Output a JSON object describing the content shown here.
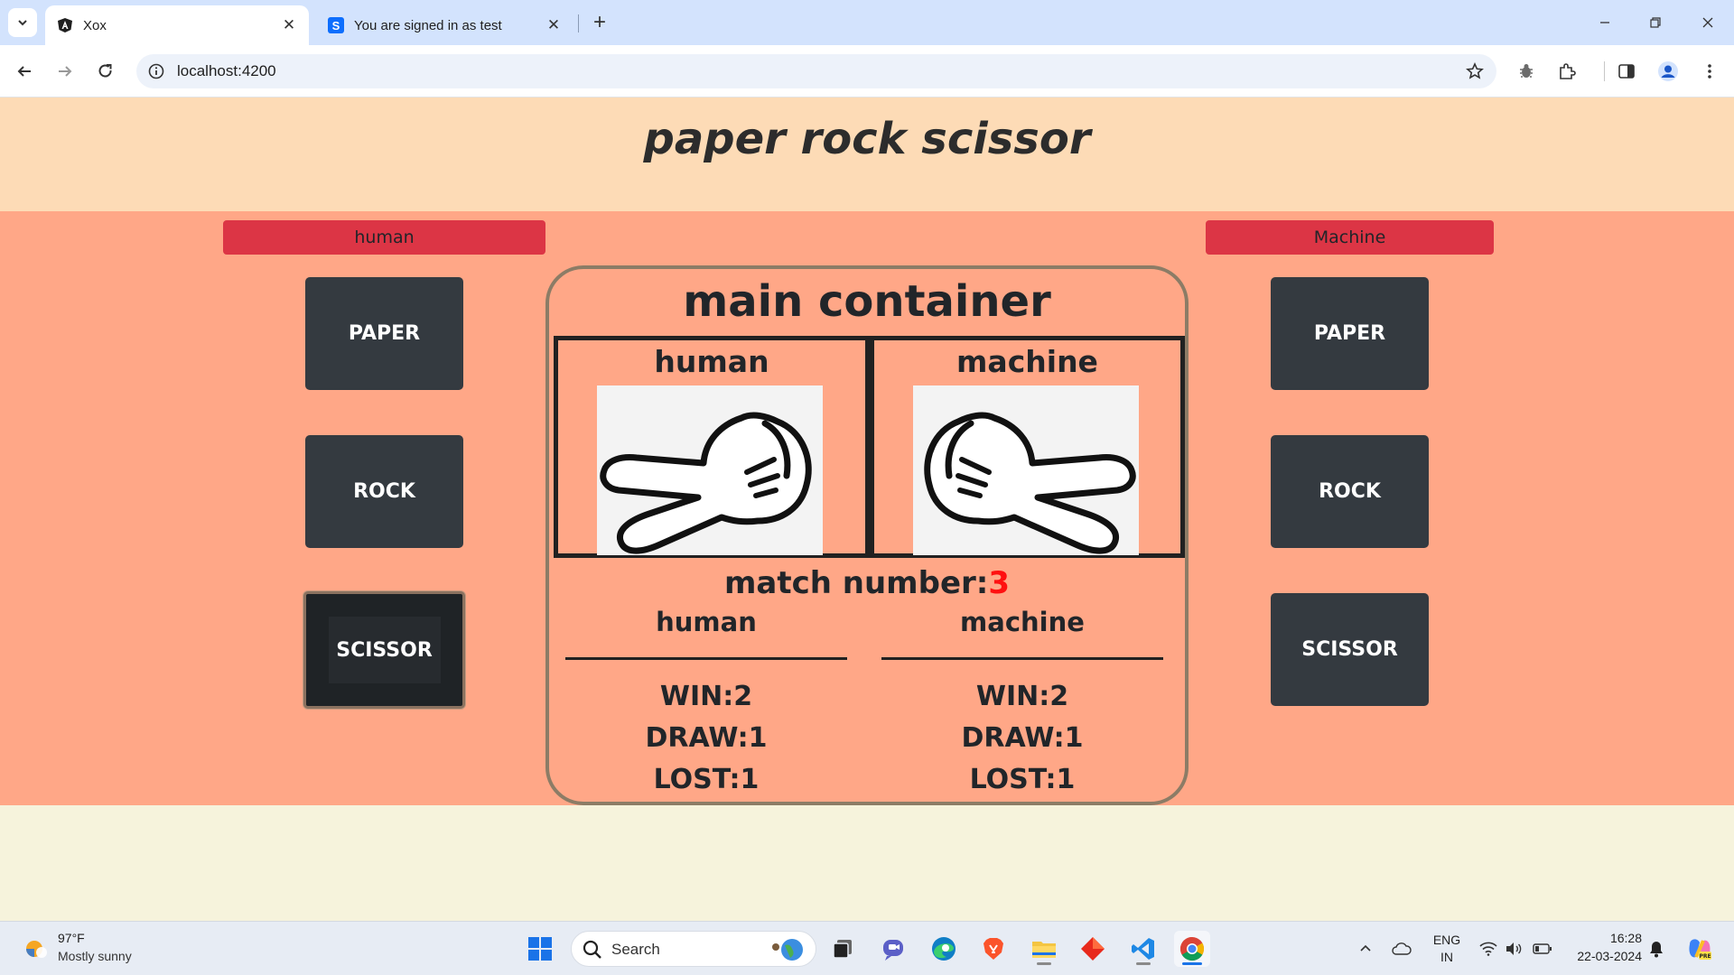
{
  "browser": {
    "tabs": [
      {
        "title": "Xox",
        "active": true,
        "favicon": "angular-icon"
      },
      {
        "title": "You are signed in as test",
        "active": false,
        "favicon": "s-logo-icon"
      }
    ],
    "url": "localhost:4200"
  },
  "app": {
    "title": "paper rock scissor",
    "human_label": "human",
    "machine_label": "Machine",
    "human_moves": [
      "PAPER",
      "ROCK",
      "SCISSOR"
    ],
    "machine_moves": [
      "PAPER",
      "ROCK",
      "SCISSOR"
    ],
    "selected_human_move": "SCISSOR",
    "main": {
      "title": "main container",
      "human_choice_label": "human",
      "machine_choice_label": "machine",
      "human_choice_icon": "scissors-hand-icon",
      "machine_choice_icon": "scissors-hand-icon",
      "match_label": "match number:",
      "match_number": "3",
      "human_score": {
        "head": "human",
        "win": "WIN:2",
        "draw": "DRAW:1",
        "lost": "LOST:1"
      },
      "machine_score": {
        "head": "machine",
        "win": "WIN:2",
        "draw": "DRAW:1",
        "lost": "LOST:1"
      }
    },
    "colors": {
      "header_bg": "#fddbb6",
      "arena_bg": "#ffa787",
      "label_bg": "#dc3545",
      "button_bg": "#343a40",
      "match_number": "#ff1010"
    }
  },
  "taskbar": {
    "weather_temp": "97°F",
    "weather_desc": "Mostly sunny",
    "search_placeholder": "Search",
    "lang_top": "ENG",
    "lang_bottom": "IN",
    "time": "16:28",
    "date": "22-03-2024"
  }
}
